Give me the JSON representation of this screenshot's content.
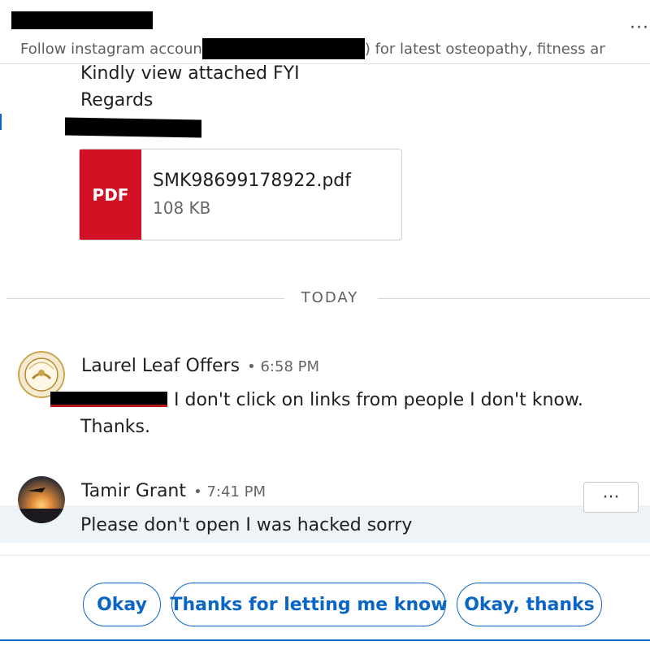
{
  "header": {
    "subtitle_prefix": "Follow instagram accoun",
    "subtitle_suffix": ") for latest osteopathy, fitness and",
    "more_label": "···"
  },
  "previous_message": {
    "lines": [
      "Kindly view attached FYI",
      "Regards"
    ],
    "attachment": {
      "badge": "PDF",
      "file_name": "SMK98699178922.pdf",
      "file_size": "108 KB",
      "badge_color": "#d11124"
    }
  },
  "divider": {
    "label": "TODAY"
  },
  "messages": [
    {
      "sender": "Laurel Leaf Offers",
      "time": "6:58 PM",
      "avatar_icon": "laurel-leaf-logo",
      "text_line1": "I don't click on links from people I don't know.",
      "text_line2": "Thanks."
    },
    {
      "sender": "Tamir Grant",
      "time": "7:41 PM",
      "avatar_icon": "sunset-photo",
      "text": "Please don't open I was hacked sorry",
      "more_label": "···"
    }
  ],
  "quick_replies": [
    "Okay",
    "Thanks for letting me know",
    "Okay, thanks"
  ],
  "colors": {
    "accent": "#0a66c2",
    "hover_bg": "#eef3f8"
  }
}
